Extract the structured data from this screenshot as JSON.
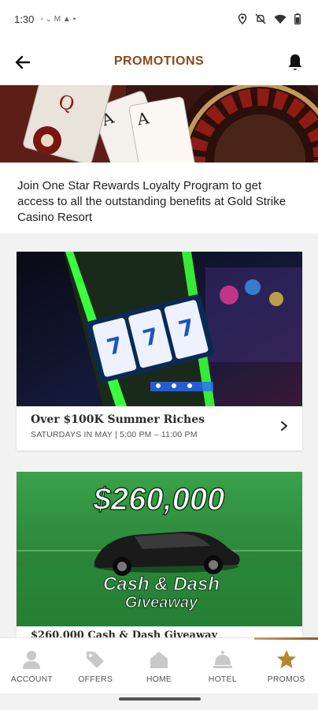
{
  "status_bar": {
    "time": "1:30",
    "icons": [
      "notification-icons",
      "location-icon",
      "mute-icon",
      "wifi-icon",
      "battery-icon"
    ]
  },
  "app_bar": {
    "title": "PROMOTIONS",
    "back_icon": "back-arrow-icon",
    "bell_icon": "bell-icon",
    "title_color": "#8b4a1e"
  },
  "intro": {
    "text": "Join One Star Rewards Loyalty Program to get access to all the outstanding benefits at Gold Strike Casino Resort"
  },
  "promotions": [
    {
      "title": "Over $100K Summer Riches",
      "subtitle": "SATURDAYS IN MAY | 5:00 PM – 11:00 PM",
      "image": "slot-machine-image"
    },
    {
      "title": "$260,000 Cash & Dash Giveaway",
      "image_heading": "$260,000",
      "image_line1": "Cash & Dash",
      "image_line2": "Giveaway",
      "image": "car-giveaway-image"
    }
  ],
  "bottom_nav": [
    {
      "label": "ACCOUNT",
      "icon": "person-icon",
      "active": false
    },
    {
      "label": "OFFERS",
      "icon": "tag-icon",
      "active": false
    },
    {
      "label": "HOME",
      "icon": "home-icon",
      "active": false
    },
    {
      "label": "HOTEL",
      "icon": "bell-service-icon",
      "active": false
    },
    {
      "label": "PROMOS",
      "icon": "star-icon",
      "active": true
    }
  ],
  "colors": {
    "accent": "#8b4a1e",
    "gold": "#b8862f",
    "inactive_icon": "#c8c8c8"
  }
}
